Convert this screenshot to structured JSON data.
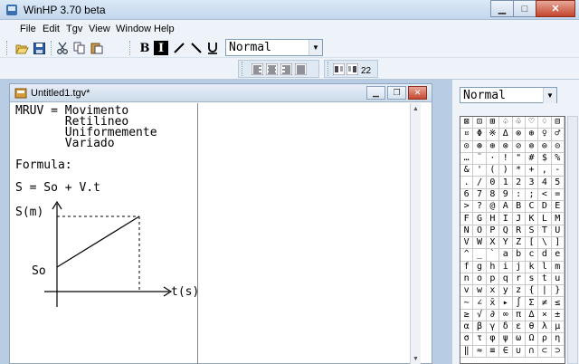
{
  "window": {
    "title": "WinHP 3.70 beta"
  },
  "menu": [
    "File",
    "Edit",
    "Tgv",
    "View",
    "Window",
    "Help"
  ],
  "toolbar": {
    "format_buttons": [
      "B",
      "I"
    ],
    "style_value": "Normal",
    "size_value": "22"
  },
  "document": {
    "title": "Untitled1.tgv*",
    "lines": [
      "MRUV = Movimento",
      "       Retilineo",
      "       Uniformemente",
      "       Variado"
    ],
    "formula_label": "Formula:",
    "formula": "S = So + V.t",
    "graph": {
      "y_label": "S(m)",
      "x_label": "t(s)",
      "origin_label": "So"
    }
  },
  "panel": {
    "style_value": "Normal",
    "charmap": [
      [
        "⊠",
        "⊡",
        "⊞",
        "♤",
        "♧",
        "♡",
        "♢",
        "⊟"
      ],
      [
        "¤",
        "Φ",
        "※",
        "Δ",
        "⊗",
        "⊕",
        "♀",
        "♂"
      ],
      [
        "⊙",
        "⊛",
        "⊕",
        "⊗",
        "⊘",
        "⊚",
        "⊜",
        "⊝"
      ],
      [
        "…",
        "¨",
        "·",
        "!",
        "\"",
        "#",
        "$",
        "%"
      ],
      [
        "&",
        "'",
        "(",
        ")",
        "*",
        "+",
        ",",
        "-"
      ],
      [
        ".",
        "/",
        "0",
        "1",
        "2",
        "3",
        "4",
        "5"
      ],
      [
        "6",
        "7",
        "8",
        "9",
        ":",
        ";",
        "<",
        "="
      ],
      [
        ">",
        "?",
        "@",
        "A",
        "B",
        "C",
        "D",
        "E"
      ],
      [
        "F",
        "G",
        "H",
        "I",
        "J",
        "K",
        "L",
        "M"
      ],
      [
        "N",
        "O",
        "P",
        "Q",
        "R",
        "S",
        "T",
        "U"
      ],
      [
        "V",
        "W",
        "X",
        "Y",
        "Z",
        "[",
        "\\",
        "]"
      ],
      [
        "^",
        "_",
        "`",
        "a",
        "b",
        "c",
        "d",
        "e"
      ],
      [
        "f",
        "g",
        "h",
        "i",
        "j",
        "k",
        "l",
        "m"
      ],
      [
        "n",
        "o",
        "p",
        "q",
        "r",
        "s",
        "t",
        "u"
      ],
      [
        "v",
        "w",
        "x",
        "y",
        "z",
        "{",
        "|",
        "}"
      ],
      [
        "~",
        "∠",
        "x̄",
        "▸",
        "∫",
        "Σ",
        "≠",
        "≤"
      ],
      [
        "≥",
        "√",
        "∂",
        "∞",
        "π",
        "∆",
        "×",
        "±"
      ],
      [
        "α",
        "β",
        "γ",
        "δ",
        "ε",
        "θ",
        "λ",
        "μ"
      ],
      [
        "σ",
        "τ",
        "φ",
        "ψ",
        "ω",
        "Ω",
        "ρ",
        "η"
      ],
      [
        "‖",
        "≈",
        "≡",
        "∈",
        "∪",
        "∩",
        "⊂",
        "⊃"
      ]
    ]
  }
}
